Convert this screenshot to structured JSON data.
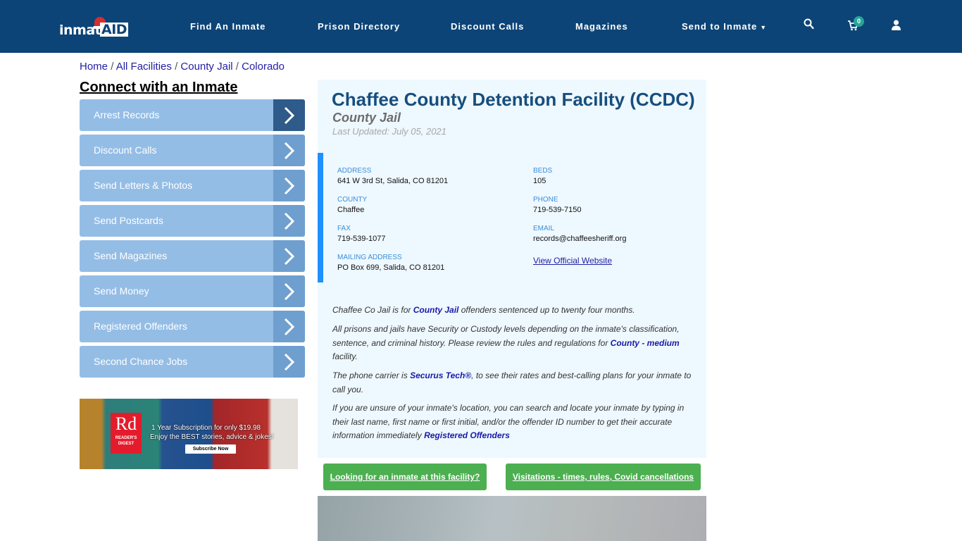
{
  "header": {
    "logo": {
      "text": "inmate",
      "accent": "AID"
    },
    "nav": [
      {
        "label": "Find An Inmate"
      },
      {
        "label": "Prison Directory"
      },
      {
        "label": "Discount Calls"
      },
      {
        "label": "Magazines"
      },
      {
        "label": "Send to Inmate",
        "has_dropdown": true
      }
    ],
    "icons": [
      "search-icon",
      "cart-icon",
      "user-icon"
    ],
    "cart_count": "0",
    "caret": "▼"
  },
  "breadcrumb": [
    {
      "label": "Home"
    },
    {
      "label": "All Facilities"
    },
    {
      "label": "County Jail"
    },
    {
      "label": "Colorado"
    }
  ],
  "breadcrumb_separator": "/",
  "sidebar": {
    "title": "Connect with an Inmate",
    "items": [
      {
        "label": "Arrest Records",
        "active": true
      },
      {
        "label": "Discount Calls"
      },
      {
        "label": "Send Letters & Photos"
      },
      {
        "label": "Send Postcards"
      },
      {
        "label": "Send Magazines"
      },
      {
        "label": "Send Money"
      },
      {
        "label": "Registered Offenders"
      },
      {
        "label": "Second Chance Jobs"
      }
    ]
  },
  "ad": {
    "brand_short": "Rd",
    "brand_line1": "READER'S",
    "brand_line2": "DIGEST",
    "line1": "1 Year Subscription for only $19.98",
    "line2": "Enjoy the BEST stories, advice & jokes!",
    "cta": "Subscribe Now"
  },
  "facility": {
    "title": "Chaffee County Detention Facility (CCDC)",
    "type": "County Jail",
    "last_updated": "Last Updated: July 05, 2021",
    "info": {
      "address_label": "ADDRESS",
      "address": "641 W 3rd St, Salida, CO 81201",
      "county_label": "COUNTY",
      "county": "Chaffee",
      "fax_label": "FAX",
      "fax": "719-539-1077",
      "mailing_label": "MAILING ADDRESS",
      "mailing": "PO Box 699, Salida, CO 81201",
      "beds_label": "BEDS",
      "beds": "105",
      "phone_label": "PHONE",
      "phone": "719-539-7150",
      "email_label": "EMAIL",
      "email": "records@chaffeesheriff.org",
      "website_link": "View Official Website"
    },
    "paragraphs": {
      "p1_a": "Chaffee Co Jail is for ",
      "p1_link": "County Jail",
      "p1_b": " offenders sentenced up to twenty four months.",
      "p2_a": "All prisons and jails have Security or Custody levels depending on the inmate's classification, sentence, and criminal history. Please review the rules and regulations for ",
      "p2_link": "County - medium",
      "p2_b": " facility.",
      "p3_a": "The phone carrier is ",
      "p3_link": "Securus Tech®",
      "p3_b": ", to see their rates and best-calling plans for your inmate to call you.",
      "p4_a": "If you are unsure of your inmate's location, you can search and locate your inmate by typing in their last name, first name or first initial, and/or the offender ID number to get their accurate information immediately ",
      "p4_link": "Registered Offenders"
    },
    "buttons": [
      {
        "label": "Looking for an inmate at this facility?"
      },
      {
        "label": "Visitations - times, rules, Covid cancellations"
      }
    ]
  },
  "colors": {
    "header_bg": "#0d4477",
    "sidebar_item": "#94bde6",
    "sidebar_arrow_active": "#2f5b8a",
    "panel_bg": "#eef8ff",
    "title": "#164e7e",
    "accent_bar": "#1e90ff",
    "button_green": "#4caf50"
  }
}
